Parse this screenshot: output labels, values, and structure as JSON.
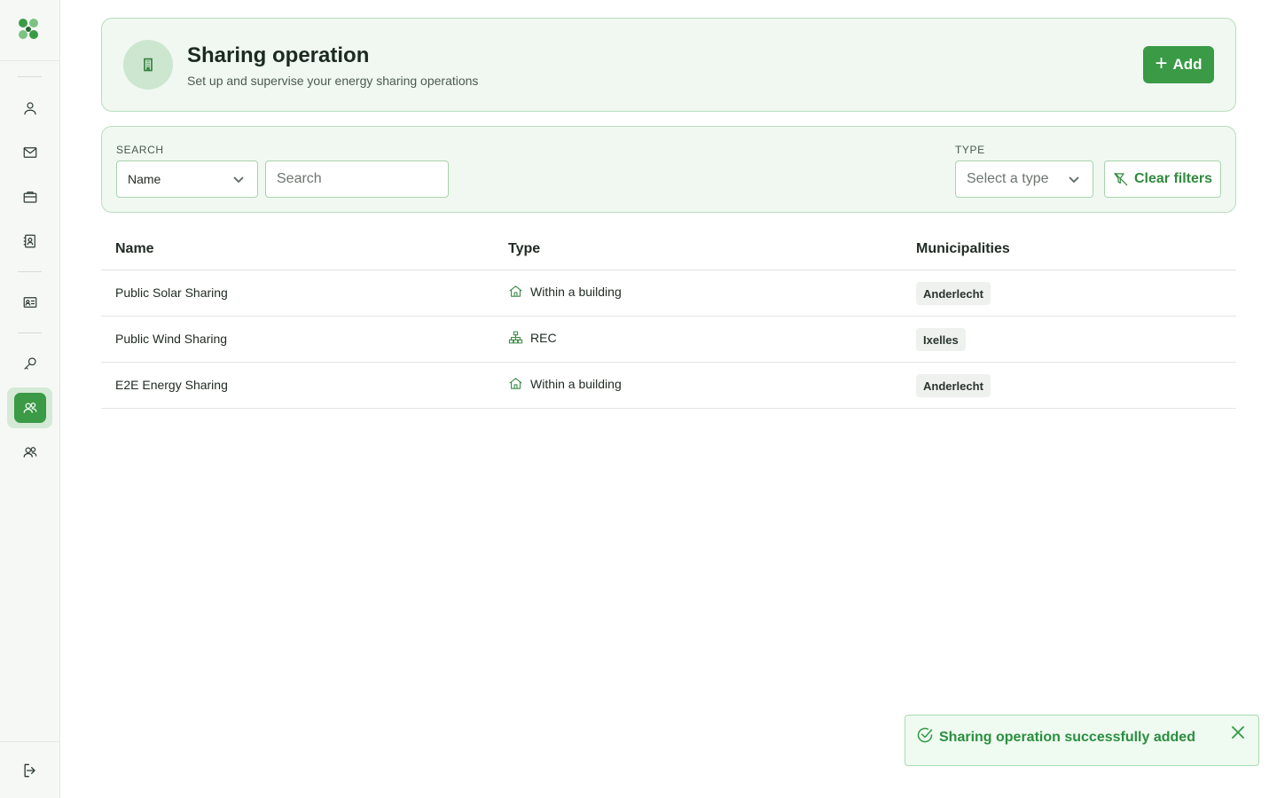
{
  "sidebar": {
    "logo": "clover-logo",
    "items": [
      {
        "icon": "user-icon",
        "active": false
      },
      {
        "icon": "mail-icon",
        "active": false
      },
      {
        "icon": "briefcase-icon",
        "active": false
      },
      {
        "icon": "contact-book-icon",
        "active": false
      },
      {
        "icon": "id-card-icon",
        "active": false
      },
      {
        "icon": "key-icon",
        "active": false
      },
      {
        "icon": "users-icon",
        "active": true
      },
      {
        "icon": "users-icon",
        "active": false
      }
    ],
    "logout_icon": "logout-icon"
  },
  "header": {
    "title": "Sharing operation",
    "subtitle": "Set up and supervise your energy sharing operations",
    "icon": "building-icon",
    "add_label": "Add"
  },
  "filters": {
    "search_label": "SEARCH",
    "search_field_value": "Name",
    "search_placeholder": "Search",
    "type_label": "TYPE",
    "type_placeholder": "Select a type",
    "clear_label": "Clear filters"
  },
  "table": {
    "columns": [
      "Name",
      "Type",
      "Municipalities"
    ],
    "rows": [
      {
        "name": "Public Solar Sharing",
        "type": "Within a building",
        "type_icon": "house-icon",
        "municipality": "Anderlecht"
      },
      {
        "name": "Public Wind Sharing",
        "type": "REC",
        "type_icon": "network-icon",
        "municipality": "Ixelles"
      },
      {
        "name": "E2E Energy Sharing",
        "type": "Within a building",
        "type_icon": "house-icon",
        "municipality": "Anderlecht"
      }
    ]
  },
  "toast": {
    "message": "Sharing operation successfully added",
    "icon": "check-circle-icon"
  },
  "colors": {
    "accent": "#3a9a46",
    "card_bg": "#f0f8f1",
    "card_border": "#b9ddbe"
  }
}
